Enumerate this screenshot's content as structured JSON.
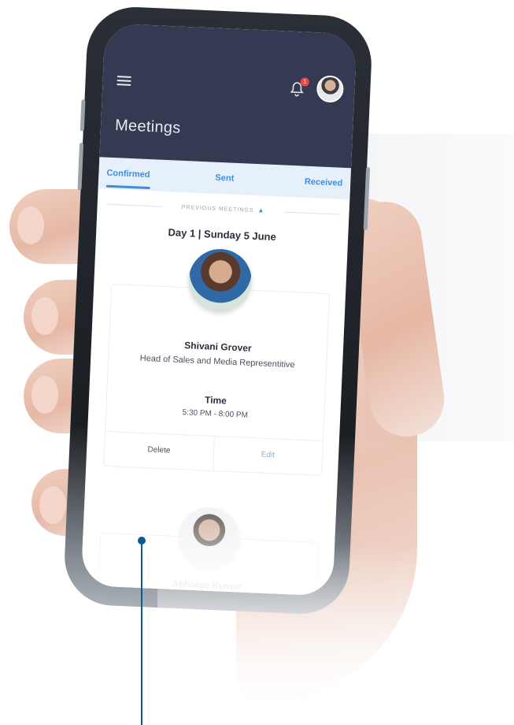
{
  "app": {
    "title": "Meetings",
    "notifications_count": "1",
    "colors": {
      "header": "#343a52",
      "accent": "#3c8ee0",
      "tab_bg": "#e6f0fa",
      "marker": "#0f5a8e"
    }
  },
  "tabs": [
    {
      "label": "Confirmed",
      "active": true
    },
    {
      "label": "Sent",
      "active": false
    },
    {
      "label": "Received",
      "active": false
    }
  ],
  "previous_meetings_label": "PREVIOUS MEETINGS",
  "day_header": "Day 1 | Sunday 5 June",
  "meetings": [
    {
      "name": "Shivani Grover",
      "role": "Head of Sales and Media Representitive",
      "time_label": "Time",
      "time": "5:30 PM - 8:00 PM",
      "actions": {
        "delete": "Delete",
        "edit": "Edit"
      }
    },
    {
      "name": "Abhinav Kumar"
    }
  ],
  "icons": [
    "menu-icon",
    "bell-icon",
    "chevron-up-icon"
  ]
}
